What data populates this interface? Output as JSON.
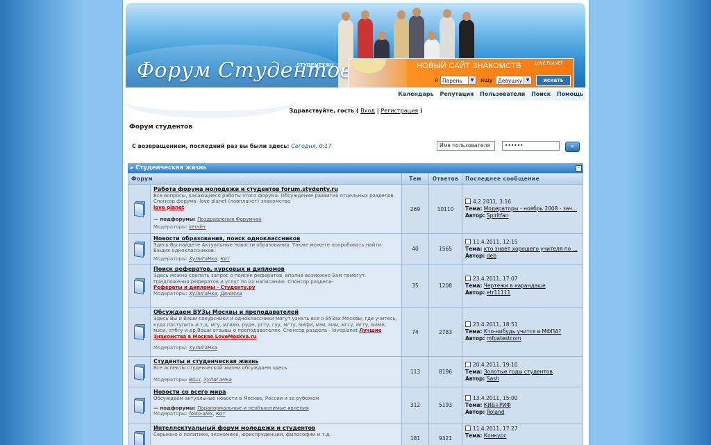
{
  "banner": {
    "title": "Форум Студентов",
    "site_small": "STYDENTY.RU",
    "ad_title": "НОВЫЙ САЙТ ЗНАКОМСТВ",
    "ad_logo": "LOVE PLANET",
    "ad_i": "я",
    "ad_seek": "ищу",
    "select_i": "Парень",
    "select_seek": "Девушку",
    "search_button": "искать"
  },
  "nav": [
    "Календарь",
    "Репутация",
    "Пользователи",
    "Поиск",
    "Помощь"
  ],
  "greeting": {
    "text": "Здравствуйте, гость",
    "open": "(",
    "login": "Вход",
    "sep": "|",
    "register": "Регистрация",
    "close": ")"
  },
  "forum_title": "Форум студентов",
  "welcome": {
    "text": "С возвращением, последний раз вы были здесь:",
    "time": "Сегодня, 0:17"
  },
  "login": {
    "username_placeholder": "Имя пользователя",
    "password_mask": "••••••",
    "go": "»"
  },
  "category": {
    "title": "Студенческая жизнь",
    "collapse": "−"
  },
  "columns": {
    "forum": "Форум",
    "topics": "Тем",
    "replies": "Ответов",
    "last": "Последнее сообщение"
  },
  "labels": {
    "subforums": "— подфорумы:",
    "moderators": "Модераторы:",
    "theme": "Тема:",
    "author": "Автор:"
  },
  "forums": [
    {
      "title": "Работа форума молодежи и студентов forum.stydenty.ru",
      "desc": "Все вопросы, касающиеся работы этого форума. Обсуждение развития отдельных разделов. Спонсор форума- love planet (лавпланет) знакомства",
      "red": "love planet",
      "subforum": "Поздравления Форумчан",
      "mods": [
        "kender"
      ],
      "topics": "269",
      "replies": "10110",
      "last_date": "4.2.2011, 3:16",
      "last_theme": "Модераторы - ноябрь 2008 - зач...",
      "last_author": "Spiritfan"
    },
    {
      "title": "Новости образования, поиск одноклассников",
      "desc": "Здесь Вы найдете Актуальные новости образования. Также можете попробовать найти Ваших одноклассников.",
      "mods": [
        "ХуЛиГаНка",
        "Кит"
      ],
      "topics": "40",
      "replies": "1565",
      "last_date": "11.4.2011, 12:15",
      "last_theme": "кто знает хорошего учителя по ...",
      "last_author": "deb"
    },
    {
      "title": "Поиск рефератов, курсовых и дипломов",
      "desc": "Здесь можно сделать запрос о поиске рефератов, вполне возможно Вам помогут. Предложения рефератов и услуг по их написанию. Спонсор раздела-",
      "red": "Рефераты и дипломы - Студенту.ру",
      "mods": [
        "ХуЛиГаНка",
        "Дениска"
      ],
      "topics": "35",
      "replies": "1208",
      "last_date": "23.4.2011, 17:07",
      "last_theme": "Чертежи в карандаше",
      "last_author": "etr11111"
    },
    {
      "title": "Обсуждаем ВУЗы Москвы и преподавателей",
      "desc": "Здесь Вы и Ваши сокурсники и одноклассники могут узнать все о ВУЗах Москвы, где учитесь, куда поступить и т.д. мгу, мгимо, рудн, ргту, гуу, мгту, мифи, мэи, маи, мгсу, мгту, мами, мэси, спбгу и др.Ваши отзывы о преподавателях. Спонсор раздела - loveplanet",
      "red": "Лучшие Знакомства в Москве LoveMoskva.ru",
      "mods": [
        "ХуЛиГаНка"
      ],
      "topics": "74",
      "replies": "2783",
      "last_date": "23.4.2011, 18:51",
      "last_theme": "Кто-нибудь учится в МФПА?",
      "last_author": "mfpatestcom"
    },
    {
      "title": "Студенты и студенческая жизнь",
      "desc": "Все аспекты студенческой жизни обсуждаем здесь",
      "mods": [
        "BiLLi",
        "ХуЛиГаНка"
      ],
      "topics": "113",
      "replies": "8196",
      "last_date": "20.4.2011, 19:10",
      "last_theme": "Золотые годы студентов",
      "last_author": "Sash"
    },
    {
      "title": "Новости со всего мира",
      "desc": "Обсуждаем актуальные новости в Москве, России и за рубежом",
      "subforum": "Паранормальные и необъяснимые явления",
      "mods": [
        "folko-alex",
        "Кит"
      ],
      "topics": "312",
      "replies": "5193",
      "last_date": "13.4.2011, 15:00",
      "last_theme": "КИБ+РИФ",
      "last_author": "Roland"
    },
    {
      "title": "Интеллектуальный форум молодежи и студентов",
      "desc": "Серьезно о политике, экономике, юриспруденции, философии и т.д.",
      "topics": "181",
      "replies": "9321",
      "last_date": "11.4.2011, 17:27",
      "last_theme": "Конкурс",
      "last_author": ""
    }
  ]
}
